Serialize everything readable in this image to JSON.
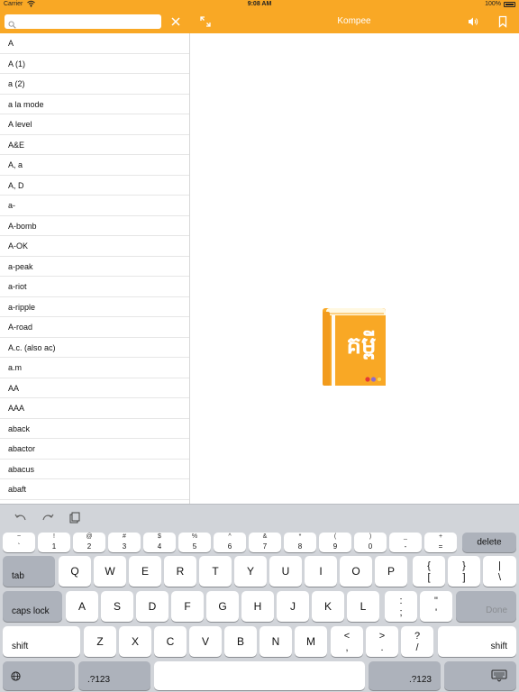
{
  "status_bar": {
    "carrier": "Carrier",
    "time": "9:08 AM",
    "battery": "100%"
  },
  "nav": {
    "title": "Kompee",
    "search_value": ""
  },
  "word_list": [
    "A",
    "A (1)",
    "a (2)",
    "a la mode",
    "A level",
    "A&E",
    "A, a",
    "A, D",
    "a-",
    "A-bomb",
    "A-OK",
    "a-peak",
    "a-riot",
    "a-ripple",
    "A-road",
    "A.c. (also ac)",
    "a.m",
    "AA",
    "AAA",
    "aback",
    "abactor",
    "abacus",
    "abaft"
  ],
  "logo": {
    "glyph": "គម្ពី",
    "color": "#f9a825"
  },
  "keyboard": {
    "number_row": [
      {
        "top": "~",
        "bot": "`"
      },
      {
        "top": "!",
        "bot": "1"
      },
      {
        "top": "@",
        "bot": "2"
      },
      {
        "top": "#",
        "bot": "3"
      },
      {
        "top": "$",
        "bot": "4"
      },
      {
        "top": "%",
        "bot": "5"
      },
      {
        "top": "^",
        "bot": "6"
      },
      {
        "top": "&",
        "bot": "7"
      },
      {
        "top": "*",
        "bot": "8"
      },
      {
        "top": "(",
        "bot": "9"
      },
      {
        "top": ")",
        "bot": "0"
      },
      {
        "top": "_",
        "bot": "-"
      },
      {
        "top": "+",
        "bot": "="
      }
    ],
    "delete": "delete",
    "tab": "tab",
    "row1": [
      "Q",
      "W",
      "E",
      "R",
      "T",
      "Y",
      "U",
      "I",
      "O",
      "P"
    ],
    "row1_extra": [
      {
        "top": "{",
        "bot": "["
      },
      {
        "top": "}",
        "bot": "]"
      },
      {
        "top": "|",
        "bot": "\\"
      }
    ],
    "caps_lock": "caps lock",
    "row2": [
      "A",
      "S",
      "D",
      "F",
      "G",
      "H",
      "J",
      "K",
      "L"
    ],
    "row2_extra": [
      {
        "top": ":",
        "bot": ";"
      },
      {
        "top": "\"",
        "bot": "'"
      }
    ],
    "done": "Done",
    "shift": "shift",
    "row3": [
      "Z",
      "X",
      "C",
      "V",
      "B",
      "N",
      "M"
    ],
    "row3_extra": [
      {
        "top": "<",
        "bot": ","
      },
      {
        "top": ">",
        "bot": "."
      },
      {
        "top": "?",
        "bot": "/"
      }
    ],
    "numbers_key": ".?123"
  }
}
